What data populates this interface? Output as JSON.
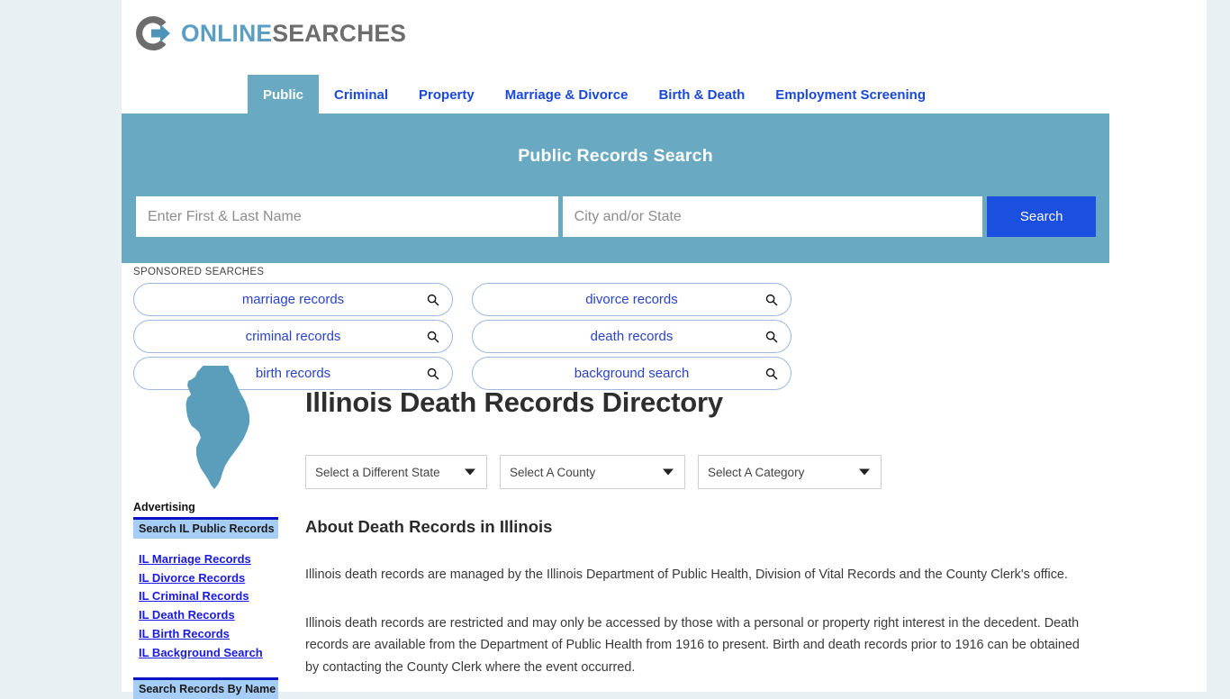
{
  "brand": {
    "logo_icon": "circle-arrow-logo-icon",
    "name_part1": "ONLINE",
    "name_part2": "SEARCHES",
    "accent_color": "#5b9ec4",
    "gray_color": "#6d6d6d"
  },
  "nav": {
    "items": [
      {
        "label": "Public",
        "active": true
      },
      {
        "label": "Criminal",
        "active": false
      },
      {
        "label": "Property",
        "active": false
      },
      {
        "label": "Marriage & Divorce",
        "active": false
      },
      {
        "label": "Birth & Death",
        "active": false
      },
      {
        "label": "Employment Screening",
        "active": false
      }
    ],
    "link_color": "#1a48d8",
    "active_bg": "#69a9c1"
  },
  "banner": {
    "title": "Public Records Search",
    "bg_color": "#69a9c1",
    "name_input": {
      "value": "",
      "placeholder": "Enter First & Last Name"
    },
    "location_input": {
      "value": "",
      "placeholder": "City and/or State"
    },
    "search_button": {
      "label": "Search",
      "color": "#1a4fe0"
    }
  },
  "sponsored": {
    "label": "SPONSORED SEARCHES",
    "pills": [
      {
        "label": "marriage records",
        "icon": "search-icon"
      },
      {
        "label": "divorce records",
        "icon": "search-icon"
      },
      {
        "label": "criminal records",
        "icon": "search-icon"
      },
      {
        "label": "death records",
        "icon": "search-icon"
      },
      {
        "label": "birth records",
        "icon": "search-icon"
      },
      {
        "label": "background search",
        "icon": "search-icon"
      }
    ],
    "pill_text_color": "#2b43c9",
    "pill_border_color": "#9cb9dd"
  },
  "state_map": {
    "state": "Illinois",
    "icon": "illinois-state-map-icon",
    "fill_color": "#5b9ebc"
  },
  "page_title": "Illinois Death Records Directory",
  "dropdowns": [
    {
      "name": "state",
      "label": "Select a Different State"
    },
    {
      "name": "county",
      "label": "Select A County"
    },
    {
      "name": "category",
      "label": "Select A Category"
    }
  ],
  "sidebar": {
    "advertising_label": "Advertising",
    "section_1_title": "Search IL Public Records",
    "links": [
      "IL Marriage Records",
      "IL Divorce Records",
      "IL Criminal Records",
      "IL Death Records",
      "IL Birth Records",
      "IL Background Search"
    ],
    "section_2_title": "Search Records By Name",
    "header_bg": "#a5cdf5",
    "header_border": "#0b14c4",
    "link_color": "#1a1ae0"
  },
  "content": {
    "heading": "About Death Records in Illinois",
    "paragraphs": [
      "Illinois death records are managed by the Illinois Department of Public Health, Division of Vital Records and the County Clerk's office.",
      "Illinois death records are restricted and may only be accessed by those with a personal or property right interest in the decedent. Death records are available from the Department of Public Health from 1916 to present. Birth and death records prior to 1916 can be obtained by contacting the County Clerk where the event occurred."
    ]
  }
}
